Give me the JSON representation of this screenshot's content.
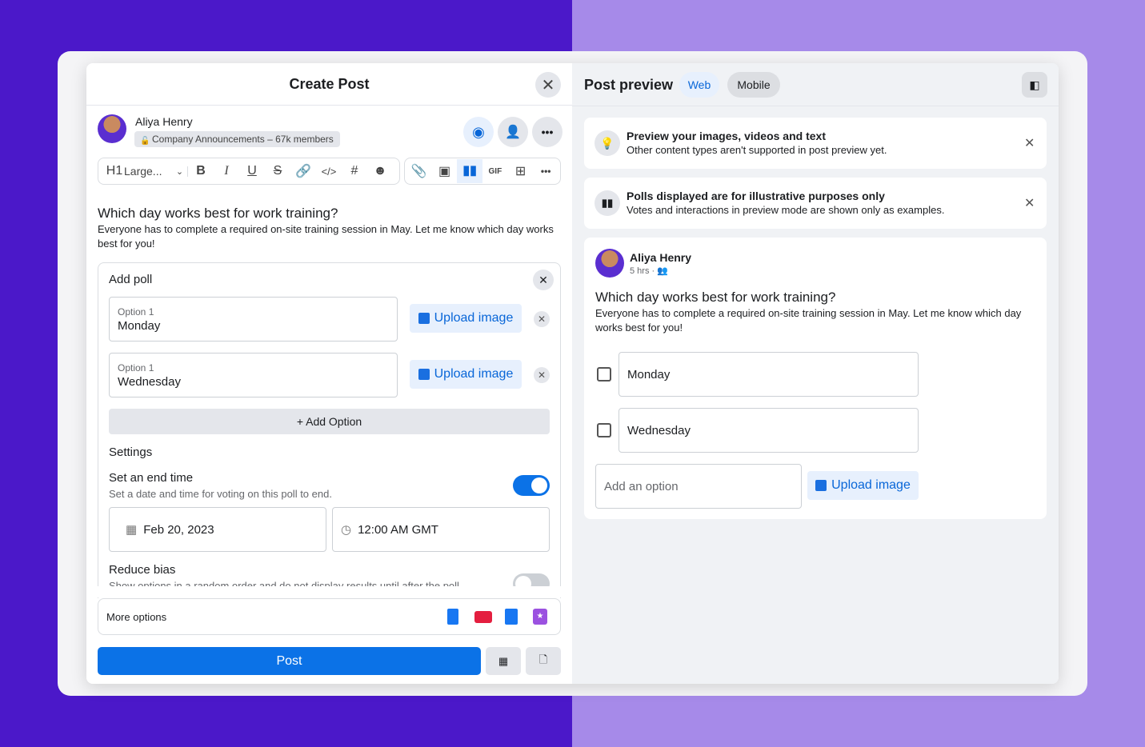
{
  "left": {
    "title": "Create Post",
    "author": "Aliya Henry",
    "audience": "Company Announcements – 67k members",
    "toolbar": {
      "heading": "H1",
      "style": "Large...",
      "icons": [
        "bold-icon",
        "italic-icon",
        "underline-icon",
        "strikethrough-icon",
        "link-icon",
        "code-icon",
        "hashtag-icon",
        "emoji-icon",
        "attachment-icon",
        "image-icon",
        "poll-icon",
        "gif-icon",
        "video-icon",
        "more-icon"
      ]
    },
    "post_title": "Which day works best for work training?",
    "post_body": "Everyone has to complete a required on-site training session in May. Let me know which day works best for you!",
    "poll": {
      "title": "Add poll",
      "options": [
        {
          "label": "Option 1",
          "value": "Monday"
        },
        {
          "label": "Option 1",
          "value": "Wednesday"
        }
      ],
      "upload_label": "Upload image",
      "add_option": "+ Add Option",
      "settings_title": "Settings",
      "end_time_title": "Set an end time",
      "end_time_desc": "Set a date and time for voting on this poll to end.",
      "end_time_on": true,
      "date": "Feb 20, 2023",
      "time": "12:00 AM GMT",
      "bias_title": "Reduce bias",
      "bias_desc": "Show options in a random order and do not display results until after the poll",
      "bias_on": false
    },
    "more_options": "More options",
    "post_button": "Post"
  },
  "right": {
    "title": "Post preview",
    "tabs": [
      "Web",
      "Mobile"
    ],
    "active_tab": "Web",
    "notices": [
      {
        "title": "Preview your images, videos and text",
        "desc": "Other content types aren't supported in post preview yet."
      },
      {
        "title": "Polls displayed are for illustrative purposes only",
        "desc": "Votes and interactions in preview mode are shown only as examples."
      }
    ],
    "author": "Aliya Henry",
    "time": "5 hrs ·",
    "post_title": "Which day works best for work training?",
    "post_body": "Everyone has to complete a required on-site training session in May. Let me know which day works best for you!",
    "options": [
      "Monday",
      "Wednesday"
    ],
    "add_placeholder": "Add an option",
    "upload_label": "Upload image"
  },
  "colors": {
    "accent": "#0866d8",
    "primary_button": "#0b72e7"
  }
}
